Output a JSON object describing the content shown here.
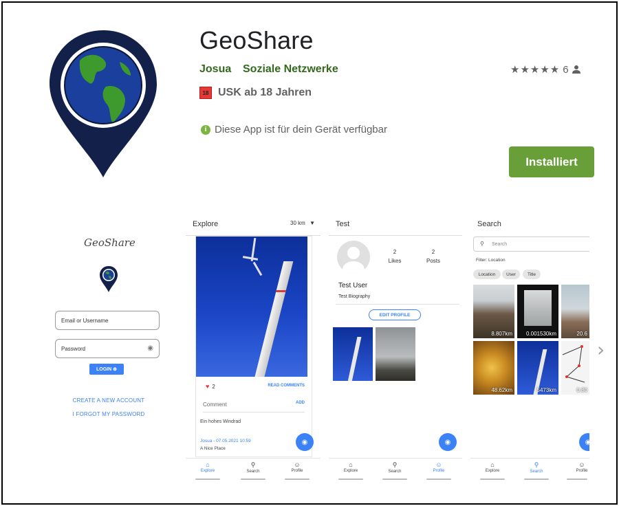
{
  "app": {
    "title": "GeoShare",
    "developer": "Josua",
    "category": "Soziale Netzwerke",
    "rating_count": "6",
    "rating_stars": "★★★★★",
    "usk_badge": "18",
    "usk_label": "USK ab 18 Jahren",
    "availability": "Diese App ist für dein Gerät verfügbar",
    "install_label": "Installiert",
    "accent_color": "#689f38",
    "developer_color": "#33691e"
  },
  "screenshots": {
    "login": {
      "logo_text": "GeoShare",
      "email_placeholder": "Email or Username",
      "password_placeholder": "Password",
      "login_button": "LOGIN ⊕",
      "create_account": "CREATE A NEW ACCOUNT",
      "forgot_password": "I FORGOT MY PASSWORD"
    },
    "explore": {
      "title": "Explore",
      "radius": "30 km",
      "likes": "2",
      "read_comments": "READ COMMENTS",
      "comment_placeholder": "Comment",
      "add": "ADD",
      "description": "Ein hohes Windrad",
      "meta": "Josua - 07.05.2021 10:59",
      "place": "A Nice Place",
      "nav": {
        "explore": "Explore",
        "search": "Search",
        "profile": "Profile"
      }
    },
    "profile": {
      "title": "Test",
      "likes_count": "2",
      "likes_label": "Likes",
      "posts_count": "2",
      "posts_label": "Posts",
      "user_name": "Test User",
      "bio": "Test Biography",
      "edit_profile": "EDIT PROFILE",
      "nav": {
        "explore": "Explore",
        "search": "Search",
        "profile": "Profile"
      }
    },
    "search": {
      "title": "Search",
      "placeholder": "Search",
      "filter_label": "Filter: Location",
      "chips": [
        "Location",
        "User",
        "Title"
      ],
      "results": [
        "8.807km",
        "0.001530km",
        "20.6",
        "48.62km",
        "5473km",
        "0.80"
      ],
      "nav": {
        "explore": "Explore",
        "search": "Search",
        "profile": "Profile"
      }
    }
  },
  "icons": {
    "app_icon": "location-pin-globe-icon",
    "person": "person-icon",
    "info": "info-icon",
    "next": "chevron-right-icon"
  }
}
